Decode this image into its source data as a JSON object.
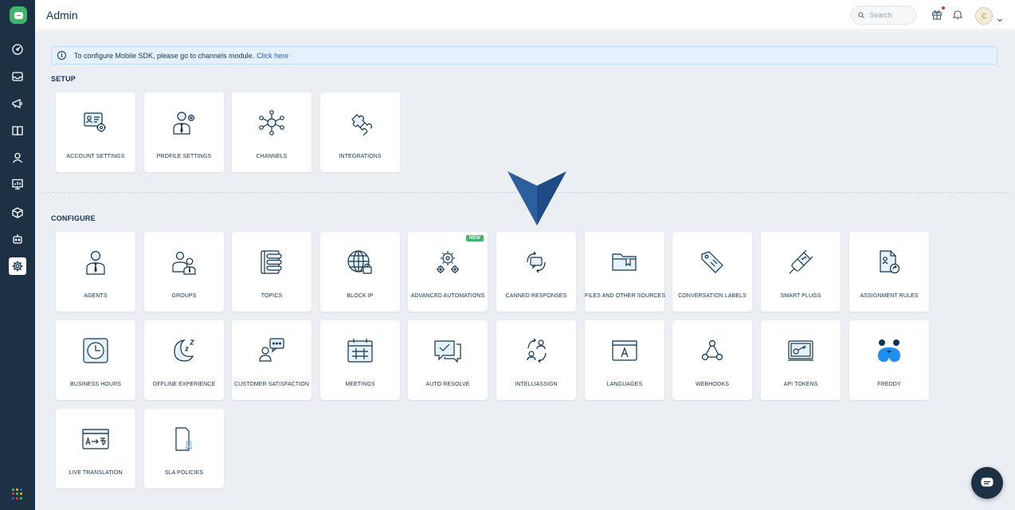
{
  "header": {
    "title": "Admin",
    "search_placeholder": "Search",
    "avatar_initial": "C"
  },
  "sidebar": {
    "items": [
      {
        "name": "dashboard-icon"
      },
      {
        "name": "inbox-icon"
      },
      {
        "name": "campaigns-icon"
      },
      {
        "name": "knowledge-base-icon"
      },
      {
        "name": "contacts-icon"
      },
      {
        "name": "analytics-icon"
      },
      {
        "name": "products-icon"
      },
      {
        "name": "bot-icon"
      },
      {
        "name": "settings-icon",
        "active": true
      }
    ]
  },
  "banner": {
    "text": "To configure Mobile SDK, please go to channels module.",
    "link": "Click here"
  },
  "setup": {
    "title": "SETUP",
    "cards": [
      {
        "label": "ACCOUNT SETTINGS",
        "icon": "account-settings-icon"
      },
      {
        "label": "PROFILE SETTINGS",
        "icon": "profile-settings-icon"
      },
      {
        "label": "CHANNELS",
        "icon": "channels-icon"
      },
      {
        "label": "INTEGRATIONS",
        "icon": "integrations-icon"
      }
    ]
  },
  "configure": {
    "title": "CONFIGURE",
    "new_badge": "NEW",
    "cards": [
      {
        "label": "AGENTS",
        "icon": "agents-icon"
      },
      {
        "label": "GROUPS",
        "icon": "groups-icon"
      },
      {
        "label": "TOPICS",
        "icon": "topics-icon"
      },
      {
        "label": "BLOCK IP",
        "icon": "block-ip-icon"
      },
      {
        "label": "ADVANCED AUTOMATIONS",
        "icon": "advanced-automations-icon"
      },
      {
        "label": "CANNED RESPONSES",
        "icon": "canned-responses-icon"
      },
      {
        "label": "FILES AND OTHER SOURCES",
        "icon": "files-icon"
      },
      {
        "label": "CONVERSATION LABELS",
        "icon": "conversation-labels-icon"
      },
      {
        "label": "SMART PLUGS",
        "icon": "smart-plugs-icon"
      },
      {
        "label": "ASSIGNMENT RULES",
        "icon": "assignment-rules-icon"
      },
      {
        "label": "BUSINESS HOURS",
        "icon": "business-hours-icon"
      },
      {
        "label": "OFFLINE EXPERIENCE",
        "icon": "offline-experience-icon"
      },
      {
        "label": "CUSTOMER SATISFACTION",
        "icon": "customer-satisfaction-icon"
      },
      {
        "label": "MEETINGS",
        "icon": "meetings-icon"
      },
      {
        "label": "AUTO RESOLVE",
        "icon": "auto-resolve-icon"
      },
      {
        "label": "INTELLIASSIGN",
        "icon": "intelliassign-icon"
      },
      {
        "label": "LANGUAGES",
        "icon": "languages-icon"
      },
      {
        "label": "WEBHOOKS",
        "icon": "webhooks-icon"
      },
      {
        "label": "API TOKENS",
        "icon": "api-tokens-icon"
      },
      {
        "label": "FREDDY",
        "icon": "freddy-icon"
      },
      {
        "label": "LIVE TRANSLATION",
        "icon": "live-translation-icon"
      },
      {
        "label": "SLA POLICIES",
        "icon": "sla-policies-icon"
      }
    ]
  },
  "colors": {
    "sidebar": "#1c3144",
    "brand": "#41b36a",
    "icon_stroke": "#12344d",
    "icon_fill": "#e5f2fd",
    "pointer": "#2c5a9c",
    "link": "#2c5cc5"
  }
}
